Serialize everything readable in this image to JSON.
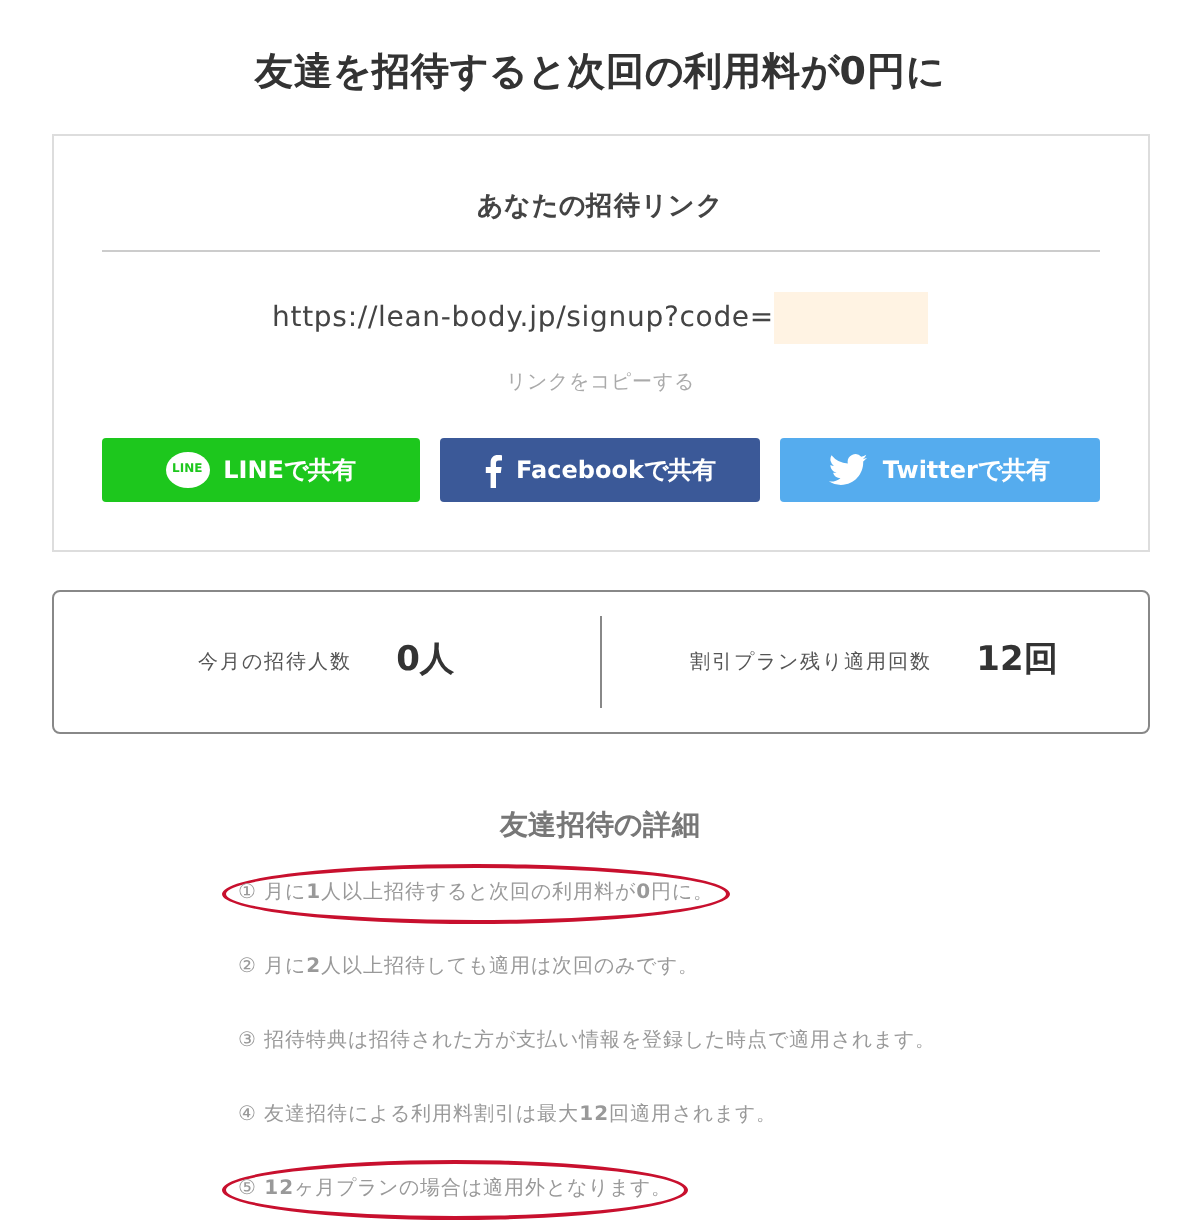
{
  "title": "友達を招待すると次回の利用料が0円に",
  "invite": {
    "heading": "あなたの招待リンク",
    "link": "https://lean-body.jp/signup?code=",
    "code_masked": true,
    "copy_label": "リンクをコピーする",
    "share_buttons": [
      {
        "kind": "line",
        "label": "LINEで共有",
        "icon_text": "LINE"
      },
      {
        "kind": "facebook",
        "label": "Facebookで共有"
      },
      {
        "kind": "twitter",
        "label": "Twitterで共有"
      }
    ]
  },
  "stats": [
    {
      "label": "今月の招待人数",
      "value": "0人"
    },
    {
      "label": "割引プラン残り適用回数",
      "value": "12回"
    }
  ],
  "details": {
    "heading": "友達招待の詳細",
    "notes": [
      {
        "text": "① 月に**1**人以上招待すると次回の利用料が**0**円に。",
        "highlighted": true
      },
      {
        "text": "② 月に**2**人以上招待しても適用は次回のみです。",
        "highlighted": false
      },
      {
        "text": "③ 招待特典は招待された方が支払い情報を登録した時点で適用されます。",
        "highlighted": false
      },
      {
        "text": "④ 友達招待による利用料割引は最大**12**回適用されます。",
        "highlighted": false
      },
      {
        "text": "⑤ **12**ヶ月プランの場合は適用外となります。",
        "highlighted": true
      }
    ]
  }
}
